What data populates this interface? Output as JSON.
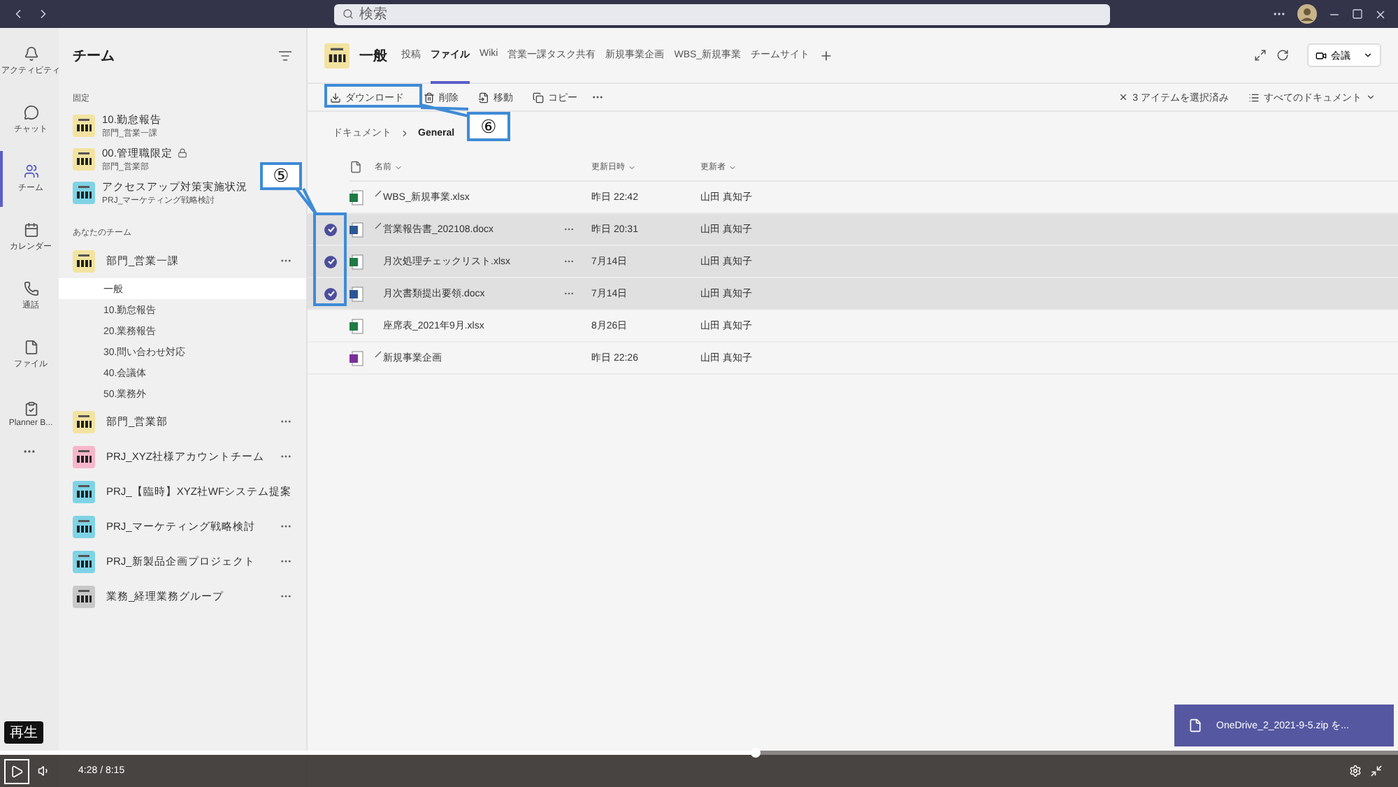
{
  "titlebar": {
    "search_placeholder": "検索"
  },
  "rail": [
    {
      "label": "アクティビティ",
      "kind": "bell",
      "selected": false
    },
    {
      "label": "チャット",
      "kind": "chat",
      "selected": false
    },
    {
      "label": "チーム",
      "kind": "teams",
      "selected": true
    },
    {
      "label": "カレンダー",
      "kind": "calendar",
      "selected": false
    },
    {
      "label": "通話",
      "kind": "phone",
      "selected": false
    },
    {
      "label": "ファイル",
      "kind": "file",
      "selected": false
    },
    {
      "label": "Planner B...",
      "kind": "planner",
      "selected": false
    }
  ],
  "team_panel": {
    "title": "チーム",
    "pinned_heading": "固定",
    "pinned": [
      {
        "name": "10.勤怠報告",
        "sub": "部門_営業一課",
        "color": "#f3e3a0",
        "locked": false
      },
      {
        "name": "00.管理職限定",
        "sub": "部門_営業部",
        "color": "#f3e3a0",
        "locked": true
      },
      {
        "name": "アクセスアップ対策実施状況",
        "sub": "PRJ_マーケティング戦略検討",
        "color": "#7fd3e6",
        "locked": false
      }
    ],
    "your_teams_heading": "あなたのチーム",
    "teams": [
      {
        "name": "部門_営業一課",
        "color": "#f3e3a0",
        "children": [
          {
            "name": "一般",
            "selected": true
          },
          {
            "name": "10.勤怠報告",
            "selected": false
          },
          {
            "name": "20.業務報告",
            "selected": false
          },
          {
            "name": "30.問い合わせ対応",
            "selected": false
          },
          {
            "name": "40.会議体",
            "selected": false
          },
          {
            "name": "50.業務外",
            "selected": false
          }
        ]
      },
      {
        "name": "部門_営業部",
        "color": "#f3e3a0"
      },
      {
        "name": "PRJ_XYZ社様アカウントチーム",
        "color": "#f7b6c9"
      },
      {
        "name": "PRJ_【臨時】XYZ社WFシステム提案",
        "color": "#7fd3e6"
      },
      {
        "name": "PRJ_マーケティング戦略検討",
        "color": "#7fd3e6"
      },
      {
        "name": "PRJ_新製品企画プロジェクト",
        "color": "#7fd3e6"
      },
      {
        "name": "業務_経理業務グループ",
        "color": "#c8c8c8"
      }
    ]
  },
  "channel": {
    "name": "一般",
    "color": "#f3e3a0",
    "tabs": [
      {
        "label": "投稿",
        "selected": false
      },
      {
        "label": "ファイル",
        "selected": true
      },
      {
        "label": "Wiki",
        "selected": false
      },
      {
        "label": "営業一課タスク共有",
        "selected": false
      },
      {
        "label": "新規事業企画",
        "selected": false
      },
      {
        "label": "WBS_新規事業",
        "selected": false
      },
      {
        "label": "チームサイト",
        "selected": false
      }
    ],
    "meeting_button": "会議"
  },
  "toolbar": {
    "actions": [
      {
        "label": "ダウンロード",
        "kind": "download"
      },
      {
        "label": "削除",
        "kind": "delete"
      },
      {
        "label": "移動",
        "kind": "move"
      },
      {
        "label": "コピー",
        "kind": "copy"
      }
    ],
    "selection": "3 アイテムを選択済み",
    "view": "すべてのドキュメント"
  },
  "breadcrumb": [
    "ドキュメント",
    "General"
  ],
  "table": {
    "columns": [
      "名前",
      "更新日時",
      "更新者"
    ],
    "rows": [
      {
        "name": "WBS_新規事業.xlsx",
        "kind": "excel",
        "marked": true,
        "modified": "昨日 22:42",
        "author": "山田 真知子",
        "selected": false
      },
      {
        "name": "営業報告書_202108.docx",
        "kind": "word",
        "marked": true,
        "modified": "昨日 20:31",
        "author": "山田 真知子",
        "selected": true
      },
      {
        "name": "月次処理チェックリスト.xlsx",
        "kind": "excel",
        "marked": false,
        "modified": "7月14日",
        "author": "山田 真知子",
        "selected": true
      },
      {
        "name": "月次書類提出要領.docx",
        "kind": "word",
        "marked": false,
        "modified": "7月14日",
        "author": "山田 真知子",
        "selected": true
      },
      {
        "name": "座席表_2021年9月.xlsx",
        "kind": "excel",
        "marked": false,
        "modified": "8月26日",
        "author": "山田 真知子",
        "selected": false
      },
      {
        "name": "新規事業企画",
        "kind": "onenote",
        "marked": true,
        "modified": "昨日 22:26",
        "author": "山田 真知子",
        "selected": false
      }
    ]
  },
  "callouts": [
    {
      "label": "⑤"
    },
    {
      "label": "⑥"
    }
  ],
  "notifications": [
    {
      "text": "OneDrive_2_2021-9-5.zip を..."
    }
  ],
  "player": {
    "tooltip": "再生",
    "time": "4:28 / 8:15",
    "level": 0.54
  }
}
